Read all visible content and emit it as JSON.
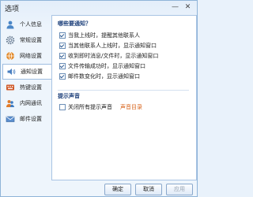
{
  "window": {
    "title": "选项",
    "minimize_glyph": "—",
    "close_glyph": "✕"
  },
  "sidebar": {
    "items": [
      {
        "label": "个人信息",
        "icon": "person-icon"
      },
      {
        "label": "常规设置",
        "icon": "gear-icon"
      },
      {
        "label": "网络设置",
        "icon": "network-icon"
      },
      {
        "label": "通知设置",
        "icon": "speaker-icon",
        "active": true
      },
      {
        "label": "热键设置",
        "icon": "keyboard-icon"
      },
      {
        "label": "内网通讯",
        "icon": "chat-icon"
      },
      {
        "label": "邮件设置",
        "icon": "mail-icon"
      }
    ]
  },
  "notify": {
    "title": "哪些要通知？",
    "options": [
      {
        "label": "当我上线时，提醒其他联系人",
        "checked": true
      },
      {
        "label": "当其他联系人上线时，显示通知窗口",
        "checked": true
      },
      {
        "label": "收到即时消息/文件时，显示通知窗口",
        "checked": true
      },
      {
        "label": "文件传输成功时，显示通知窗口",
        "checked": true
      },
      {
        "label": "邮件数变化时，显示通知窗口",
        "checked": true
      }
    ]
  },
  "sound": {
    "title": "提示声音",
    "mute_label": "关闭所有提示声音",
    "mute_checked": false,
    "directory_link": "声音目录"
  },
  "footer": {
    "ok": "确定",
    "cancel": "取消",
    "apply": "应用"
  },
  "colors": {
    "accent": "#1c3f7a",
    "link": "#d8651e",
    "border": "#8fb4d8"
  }
}
